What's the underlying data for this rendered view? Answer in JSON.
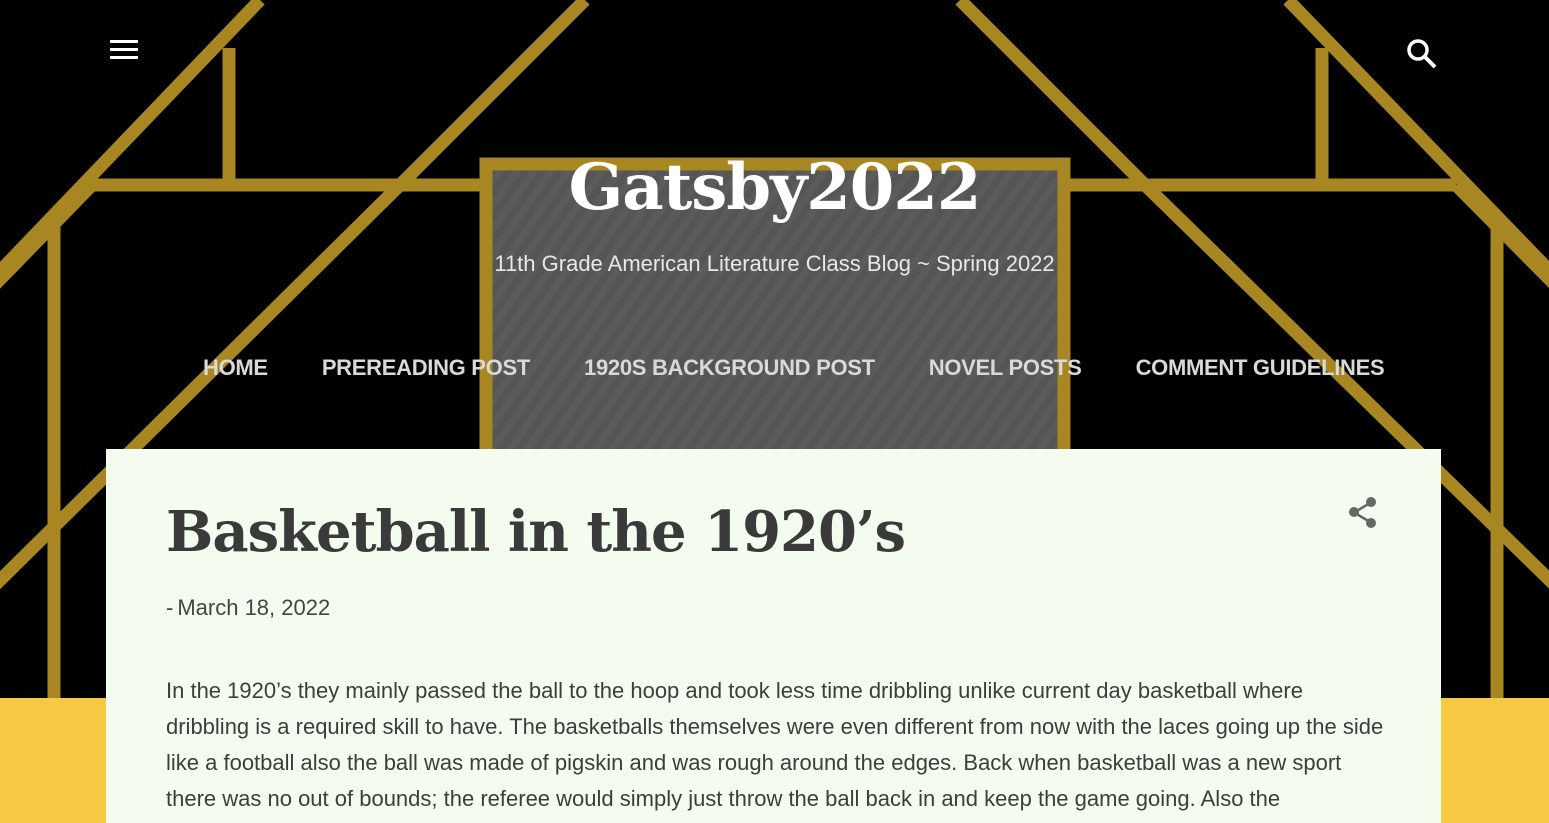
{
  "header": {
    "menu_icon": "hamburger-menu-icon",
    "search_icon": "search-icon",
    "title": "Gatsby2022",
    "description": "11th Grade American Literature Class Blog ~ Spring 2022",
    "nav": [
      {
        "label": "HOME"
      },
      {
        "label": "PREREADING POST"
      },
      {
        "label": "1920S BACKGROUND POST"
      },
      {
        "label": "NOVEL POSTS"
      },
      {
        "label": "COMMENT GUIDELINES"
      }
    ]
  },
  "post": {
    "title": "Basketball in the 1920’s",
    "date_prefix": "-",
    "date": "March 18, 2022",
    "share_icon": "share-icon",
    "body": "In the 1920’s they mainly passed the ball to the hoop and took less time dribbling unlike current day basketball where dribbling is a required skill to have. The basketballs themselves were even different from now with the laces going up the side like a football also the ball was made of pigskin and was rough around the edges. Back when basketball was a new sport there was no out of bounds; the referee would simply just throw the ball back in and keep the game going. Also the"
  },
  "colors": {
    "gold": "#a88622",
    "panel_gray": "#555555",
    "card_bg": "#f4fcf0",
    "yellow": "#f5c944"
  }
}
